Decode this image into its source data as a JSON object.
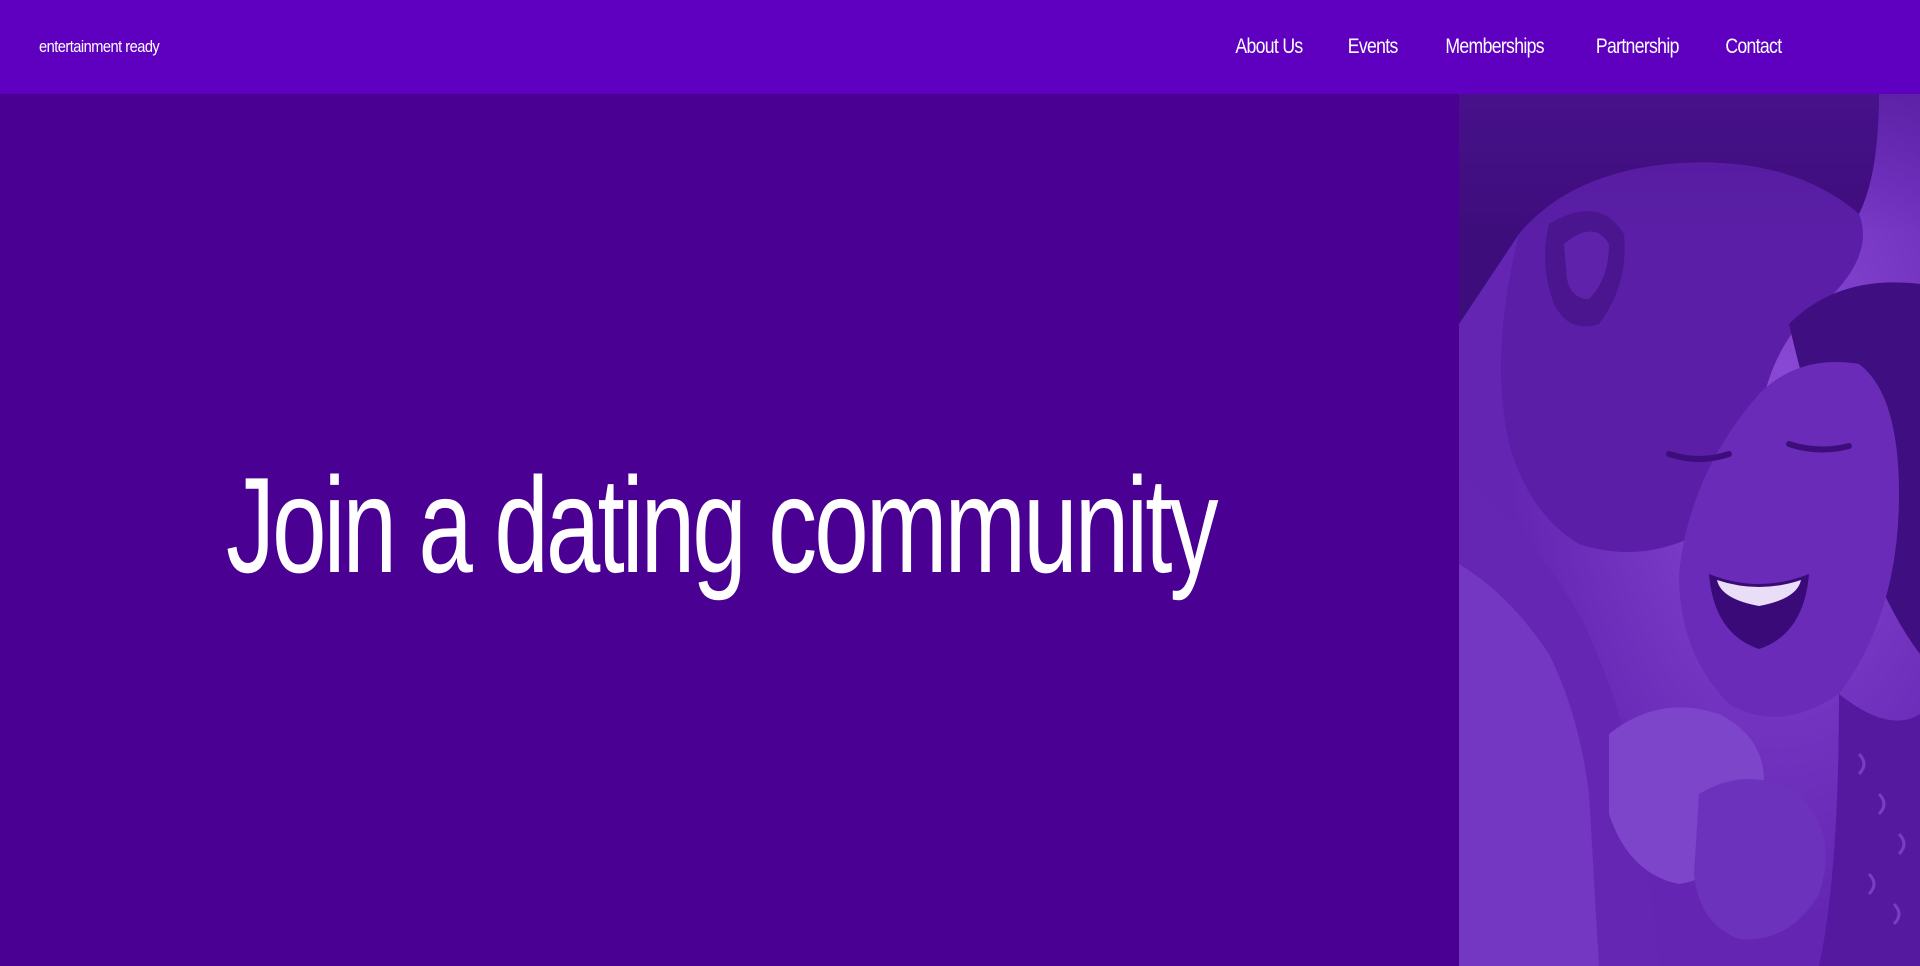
{
  "header": {
    "logo_text": "entertainment ready",
    "nav": {
      "about": "About Us",
      "events": "Events",
      "memberships": "Memberships",
      "partnership": "Partnership",
      "contact": "Contact"
    }
  },
  "hero": {
    "title": "Join a dating community"
  },
  "colors": {
    "header_bg": "#5f00c1",
    "hero_bg": "#4a0093",
    "photo_tint": "#6a2cb8",
    "text": "#ffffff"
  }
}
